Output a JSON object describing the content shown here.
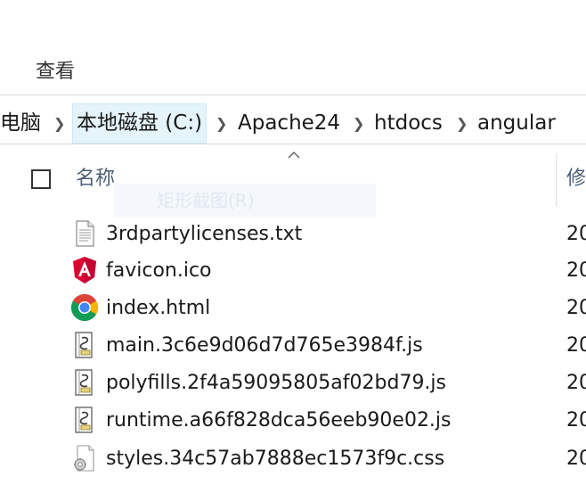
{
  "ribbon": {
    "view_tab": "查看"
  },
  "breadcrumb": {
    "items": [
      "电脑",
      "本地磁盘 (C:)",
      "Apache24",
      "htdocs",
      "angular"
    ]
  },
  "columns": {
    "name": "名称",
    "modified": "修"
  },
  "ghost_menu": {
    "label": "矩形截图(R)"
  },
  "files": [
    {
      "name": "3rdpartylicenses.txt",
      "date": "20",
      "icon": "text-file-icon"
    },
    {
      "name": "favicon.ico",
      "date": "20",
      "icon": "angular-icon"
    },
    {
      "name": "index.html",
      "date": "20",
      "icon": "chrome-icon"
    },
    {
      "name": "main.3c6e9d06d7d765e3984f.js",
      "date": "20",
      "icon": "script-file-icon"
    },
    {
      "name": "polyfills.2f4a59095805af02bd79.js",
      "date": "20",
      "icon": "script-file-icon"
    },
    {
      "name": "runtime.a66f828dca56eeb90e02.js",
      "date": "20",
      "icon": "script-file-icon"
    },
    {
      "name": "styles.34c57ab7888ec1573f9c.css",
      "date": "20",
      "icon": "css-file-icon"
    }
  ]
}
